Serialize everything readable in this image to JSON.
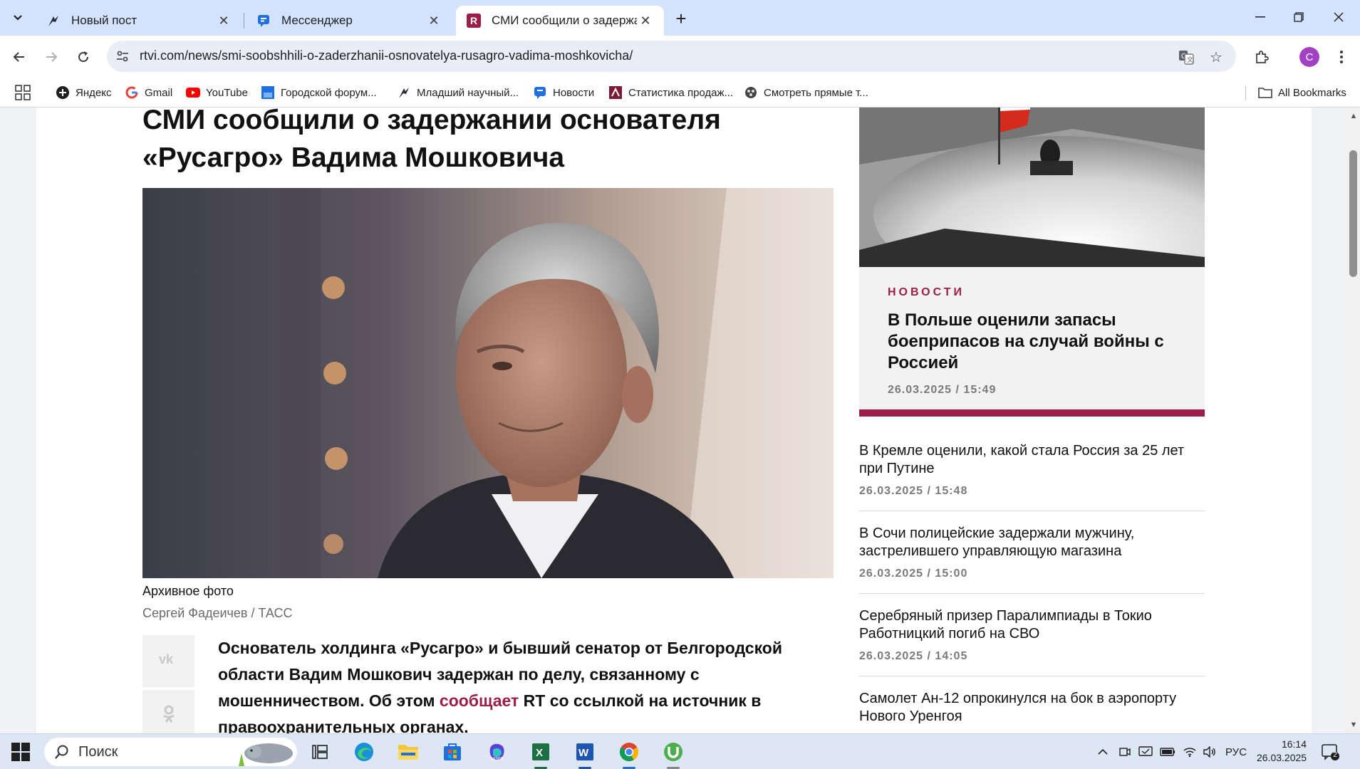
{
  "browser": {
    "tabs": [
      {
        "title": "Новый пост",
        "icon": "feather-icon"
      },
      {
        "title": "Мессенджер",
        "icon": "chat-icon"
      },
      {
        "title": "СМИ сообщили о задержании",
        "icon": "rtvi-icon",
        "active": true
      }
    ],
    "url": "rtvi.com/news/smi-soobshhili-o-zaderzhanii-osnovatelya-rusagro-vadima-moshkovicha/",
    "profile_initial": "C",
    "bookmarks": [
      {
        "label": "Яндекс",
        "icon": "yandex-icon"
      },
      {
        "label": "Gmail",
        "icon": "google-icon"
      },
      {
        "label": "YouTube",
        "icon": "youtube-icon"
      },
      {
        "label": "Городской форум...",
        "icon": "forum-icon"
      },
      {
        "label": "Младший научный...",
        "icon": "feather-icon"
      },
      {
        "label": "Новости",
        "icon": "chat-icon"
      },
      {
        "label": "Статистика продаж...",
        "icon": "stats-icon"
      },
      {
        "label": "Смотреть прямые т...",
        "icon": "tv-icon"
      }
    ],
    "all_bookmarks": "All Bookmarks"
  },
  "article": {
    "title": "СМИ сообщили о задержании основателя «Русагро» Вадима Мошковича",
    "photo_caption": "Архивное фото",
    "photo_credit": "Сергей Фадеичев / ТАСС",
    "share": [
      "vk-icon",
      "odnoklassniki-icon"
    ],
    "lead_part1": "Основатель холдинга «Русагро» и бывший сенатор от Белгородской области Вадим Мошкович задержан по делу, связанному с мошенничеством. Об этом ",
    "lead_link": "сообщает",
    "lead_part2": " RT со ссылкой на источник в правоохранительных органах."
  },
  "sidebar": {
    "featured": {
      "category": "НОВОСТИ",
      "title": "В Польше оценили запасы боеприпасов на случай войны с Россией",
      "time": "26.03.2025 / 15:49"
    },
    "news": [
      {
        "title": "В Кремле оценили, какой стала Россия за 25 лет при Путине",
        "time": "26.03.2025 / 15:48"
      },
      {
        "title": "В Сочи полицейские задержали мужчину, застрелившего управляющую магазина",
        "time": "26.03.2025 / 15:00"
      },
      {
        "title": "Серебряный призер Паралимпиады в Токио Работницкий погиб на СВО",
        "time": "26.03.2025 / 14:05"
      },
      {
        "title": "Самолет Ан-12 опрокинулся на бок в аэропорту Нового Уренгоя",
        "time": ""
      }
    ]
  },
  "taskbar": {
    "search_placeholder": "Поиск",
    "apps": [
      "task-view-icon",
      "edge-icon",
      "file-explorer-icon",
      "store-icon",
      "m365-icon",
      "excel-icon",
      "word-icon",
      "chrome-icon",
      "utorrent-icon"
    ],
    "language": "РУС",
    "time": "16:14",
    "date": "26.03.2025",
    "notification_count": "2"
  },
  "colors": {
    "accent": "#9b1e4a",
    "tabstrip": "#d3e3fd",
    "profile": "#a142c4"
  }
}
